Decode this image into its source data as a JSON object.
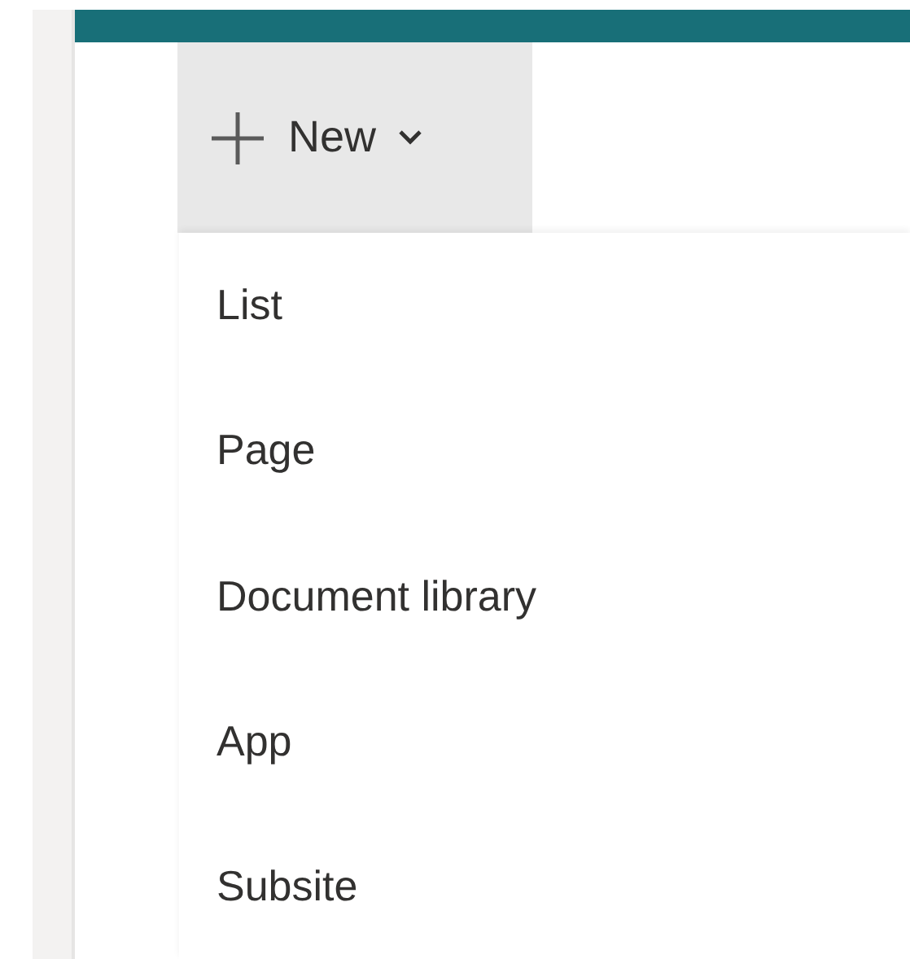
{
  "new_button": {
    "label": "New",
    "expanded": true
  },
  "menu": {
    "items": [
      {
        "label": "List"
      },
      {
        "label": "Page"
      },
      {
        "label": "Document library"
      },
      {
        "label": "App"
      },
      {
        "label": "Subsite"
      }
    ]
  }
}
